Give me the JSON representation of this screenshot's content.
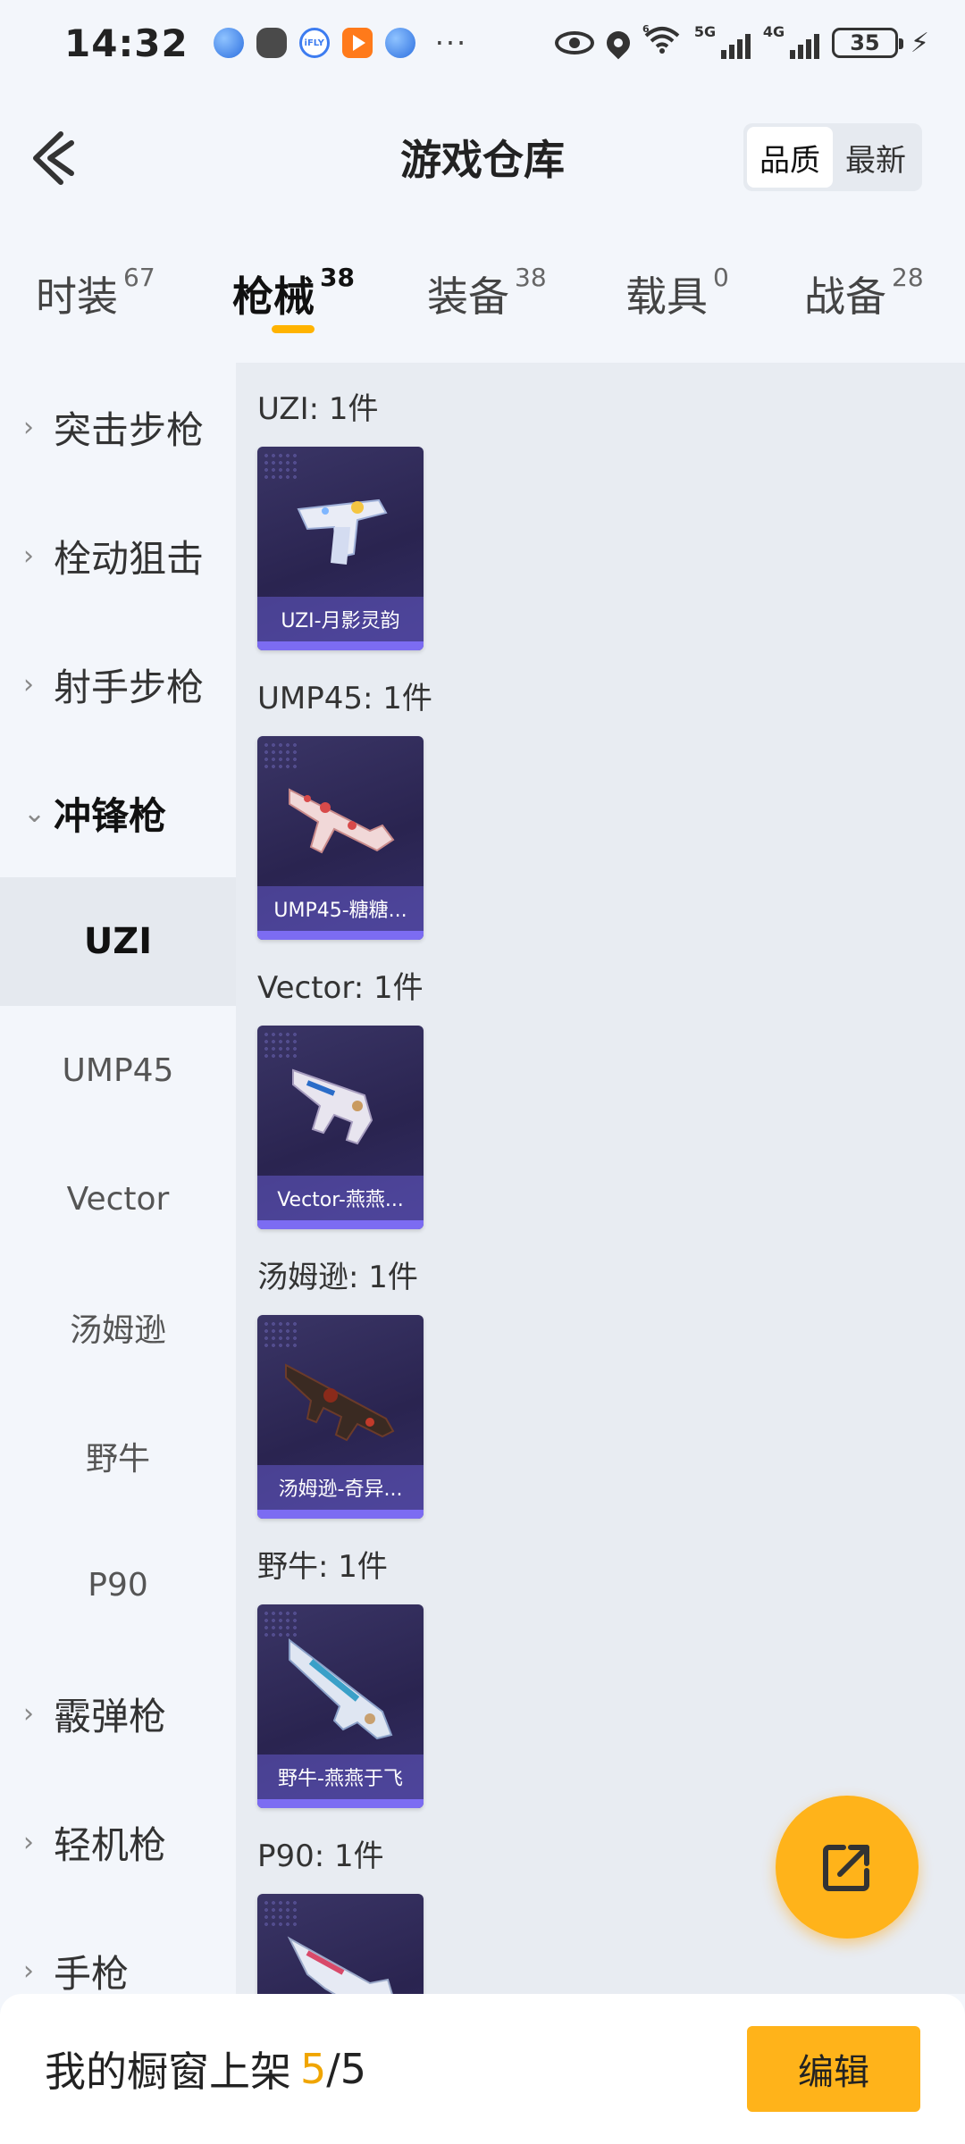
{
  "status": {
    "time": "14:32",
    "app_icons": [
      "browser-icon",
      "wechat-icon",
      "ifly-icon",
      "video-icon",
      "browser-icon"
    ],
    "more": "···",
    "ifly_label": "iFLY",
    "network_1": "5G",
    "network_2": "4G",
    "wifi_badge": "6",
    "battery": "35"
  },
  "header": {
    "title": "游戏仓库",
    "sort_options": [
      "品质",
      "最新"
    ],
    "sort_selected": "品质"
  },
  "tabs": [
    {
      "label": "时装",
      "count": "67"
    },
    {
      "label": "枪械",
      "count": "38",
      "active": true
    },
    {
      "label": "装备",
      "count": "38"
    },
    {
      "label": "载具",
      "count": "0"
    },
    {
      "label": "战备",
      "count": "28"
    }
  ],
  "sidebar": {
    "groups": [
      {
        "label": "突击步枪"
      },
      {
        "label": "栓动狙击"
      },
      {
        "label": "射手步枪"
      },
      {
        "label": "冲锋枪",
        "open": true
      }
    ],
    "subitems": [
      "UZI",
      "UMP45",
      "Vector",
      "汤姆逊",
      "野牛",
      "P90"
    ],
    "active_subitem": "UZI",
    "more_groups": [
      {
        "label": "霰弹枪"
      },
      {
        "label": "轻机枪"
      },
      {
        "label": "手枪"
      }
    ]
  },
  "sections": [
    {
      "title": "UZI: 1件",
      "item": "UZI-月影灵韵"
    },
    {
      "title": "UMP45: 1件",
      "item": "UMP45-糖糖..."
    },
    {
      "title": "Vector: 1件",
      "item": "Vector-燕燕..."
    },
    {
      "title": "汤姆逊: 1件",
      "item": "汤姆逊-奇异..."
    },
    {
      "title": "野牛: 1件",
      "item": "野牛-燕燕于飞"
    },
    {
      "title": "P90: 1件",
      "item": ""
    }
  ],
  "bottom": {
    "label": "我的橱窗上架",
    "count": "5",
    "sep": "/",
    "total": "5",
    "edit_label": "编辑"
  },
  "colors": {
    "accent": "#ffb31a",
    "card_bg": "#2a2450",
    "card_caption": "#7c6cf2"
  }
}
